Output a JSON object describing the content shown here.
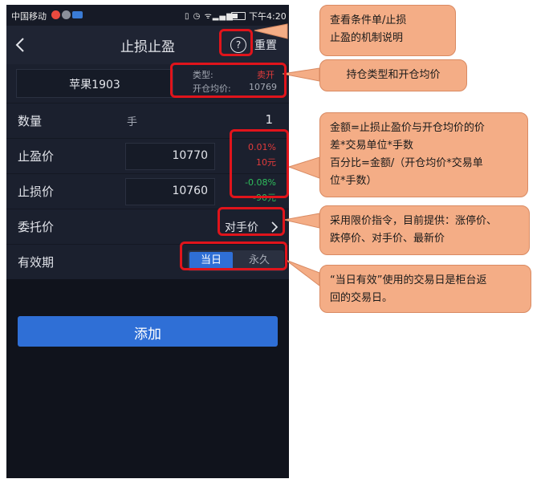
{
  "status_bar": {
    "carrier": "中国移动",
    "time": "下午4:20"
  },
  "nav": {
    "title": "止损止盈",
    "help_icon": "?",
    "reset_label": "重置"
  },
  "contract": {
    "name": "苹果1903",
    "type_label": "类型:",
    "type_value": "卖开",
    "avg_label": "开仓均价:",
    "avg_value": "10769"
  },
  "quantity": {
    "label": "数量",
    "unit": "手",
    "value": "1"
  },
  "take_profit": {
    "label": "止盈价",
    "value": "10770",
    "percent": "0.01%",
    "amount": "10元"
  },
  "stop_loss": {
    "label": "止损价",
    "value": "10760",
    "percent": "-0.08%",
    "amount": "-90元"
  },
  "order_price": {
    "label": "委托价",
    "value": "对手价"
  },
  "validity": {
    "label": "有效期",
    "options": [
      "当日",
      "永久"
    ],
    "selected": "当日"
  },
  "add_button": "添加",
  "annotations": {
    "help": [
      "查看条件单/止损",
      "止盈的机制说明"
    ],
    "position": "持仓类型和开仓均价",
    "amount": [
      "金额=止损止盈价与开仓均价的价",
      "差*交易单位*手数",
      "百分比=金额/（开仓均价*交易单",
      "位*手数）"
    ],
    "order": [
      "采用限价指令，目前提供：涨停价、",
      "跌停价、对手价、最新价"
    ],
    "validity": [
      "“当日有效”使用的交易日是柜台返",
      "回的交易日。"
    ]
  },
  "colors": {
    "phone_bg": "#1b202e",
    "accent": "#2f6fd6",
    "highlight": "#e0141b",
    "callout": "#f4ad86",
    "profit": "#e23b3b",
    "loss": "#2fbe5c"
  }
}
